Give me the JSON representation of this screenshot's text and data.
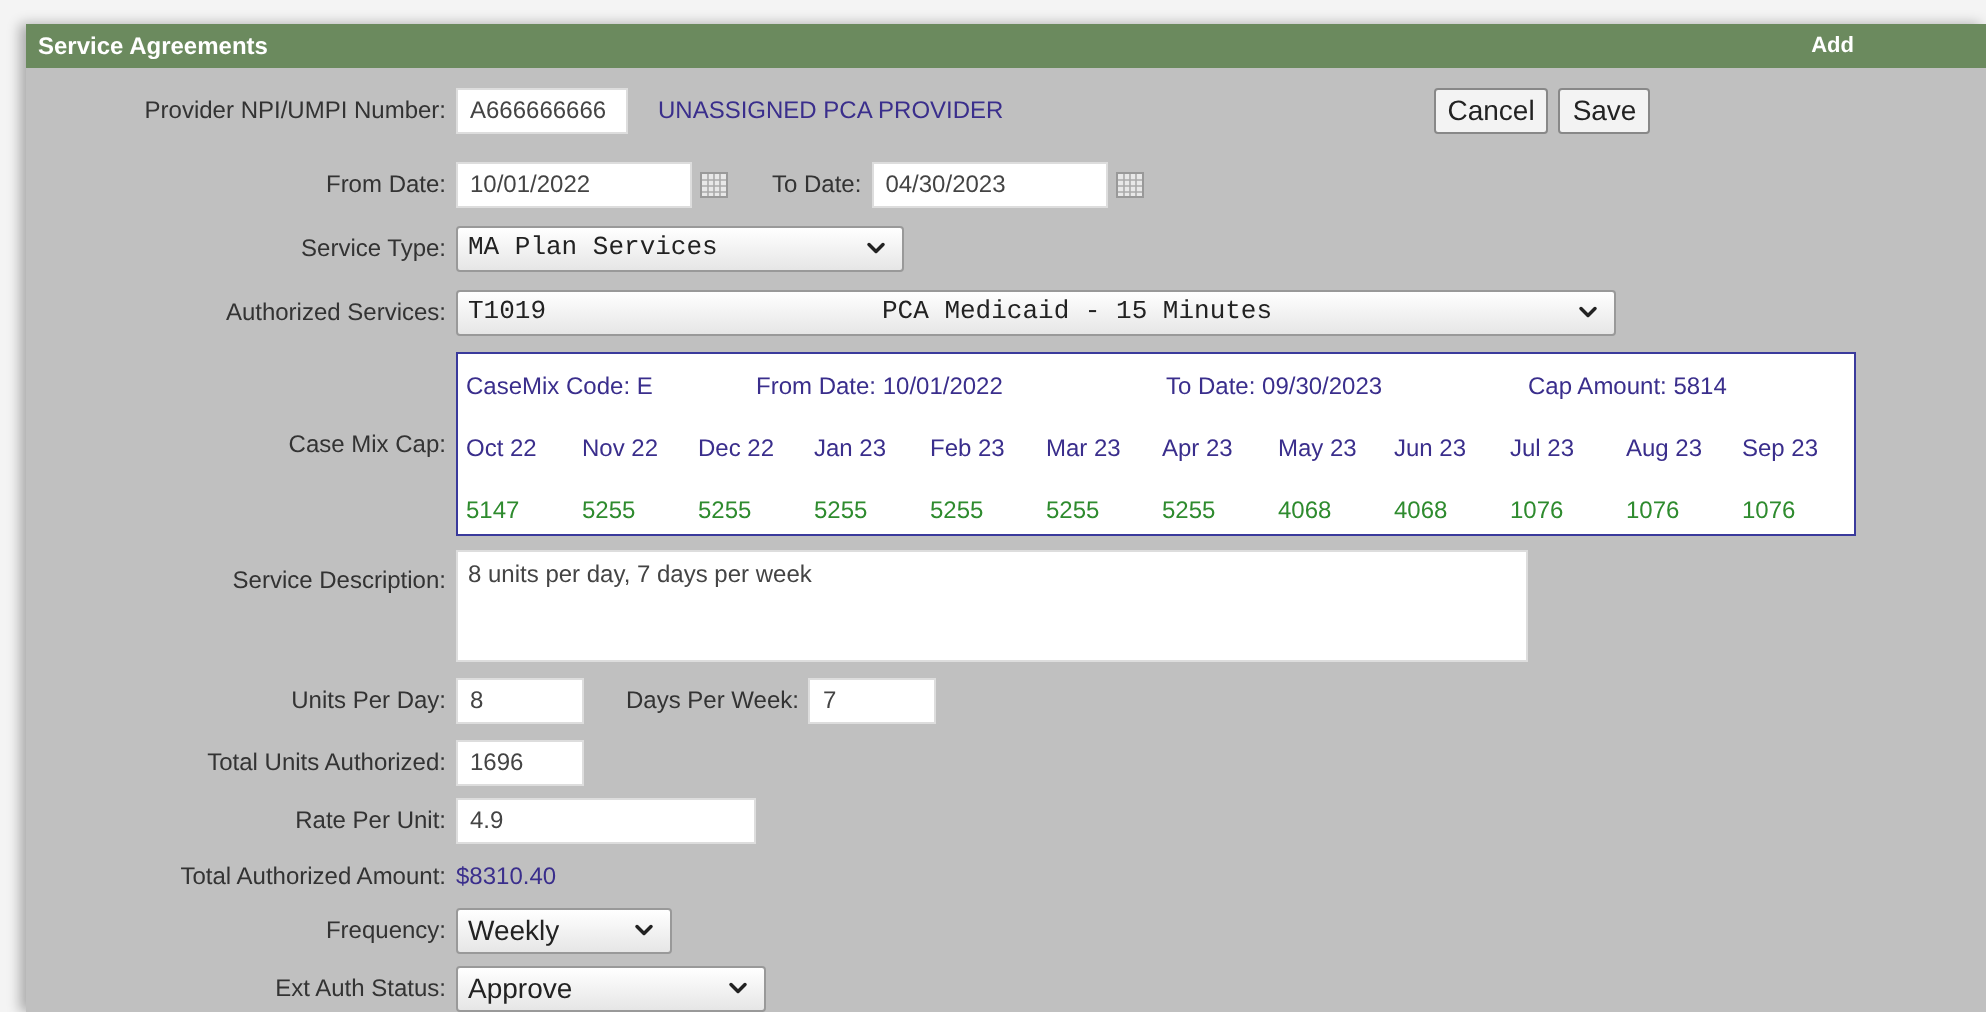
{
  "header": {
    "title": "Service Agreements",
    "action": "Add"
  },
  "provider": {
    "label": "Provider NPI/UMPI Number:",
    "value": "A666666666",
    "name": "UNASSIGNED PCA PROVIDER"
  },
  "buttons": [
    "Cancel",
    "Save"
  ],
  "from_date": {
    "label": "From Date:",
    "value": "10/01/2022"
  },
  "to_date": {
    "label": "To Date:",
    "value": "04/30/2023"
  },
  "service_type": {
    "label": "Service Type:",
    "value": "MA Plan Services"
  },
  "authorized_services": {
    "label": "Authorized Services:",
    "code": "T1019",
    "description": "PCA Medicaid - 15 Minutes"
  },
  "case_mix_cap": {
    "label": "Case Mix Cap:",
    "code": "CaseMix Code: E",
    "from_date": "From Date: 10/01/2022",
    "to_date": "To Date: 09/30/2023",
    "cap_amount": "Cap Amount: 5814",
    "months": [
      {
        "month": "Oct 22",
        "amount": "5147"
      },
      {
        "month": "Nov 22",
        "amount": "5255"
      },
      {
        "month": "Dec 22",
        "amount": "5255"
      },
      {
        "month": "Jan 23",
        "amount": "5255"
      },
      {
        "month": "Feb 23",
        "amount": "5255"
      },
      {
        "month": "Mar 23",
        "amount": "5255"
      },
      {
        "month": "Apr 23",
        "amount": "5255"
      },
      {
        "month": "May 23",
        "amount": "4068"
      },
      {
        "month": "Jun 23",
        "amount": "4068"
      },
      {
        "month": "Jul 23",
        "amount": "1076"
      },
      {
        "month": "Aug 23",
        "amount": "1076"
      },
      {
        "month": "Sep 23",
        "amount": "1076"
      }
    ]
  },
  "service_description": {
    "label": "Service Description:",
    "value": "8 units per day, 7 days per week"
  },
  "units_per_day": {
    "label": "Units Per Day:",
    "value": "8"
  },
  "days_per_week": {
    "label": "Days Per Week:",
    "value": "7"
  },
  "total_units": {
    "label": "Total Units Authorized:",
    "value": "1696"
  },
  "rate_per_unit": {
    "label": "Rate Per Unit:",
    "value": "4.9"
  },
  "total_amount": {
    "label": "Total Authorized Amount:",
    "value": "$8310.40"
  },
  "frequency": {
    "label": "Frequency:",
    "value": "Weekly"
  },
  "ext_auth_status": {
    "label": "Ext Auth Status:",
    "value": "Approve"
  }
}
